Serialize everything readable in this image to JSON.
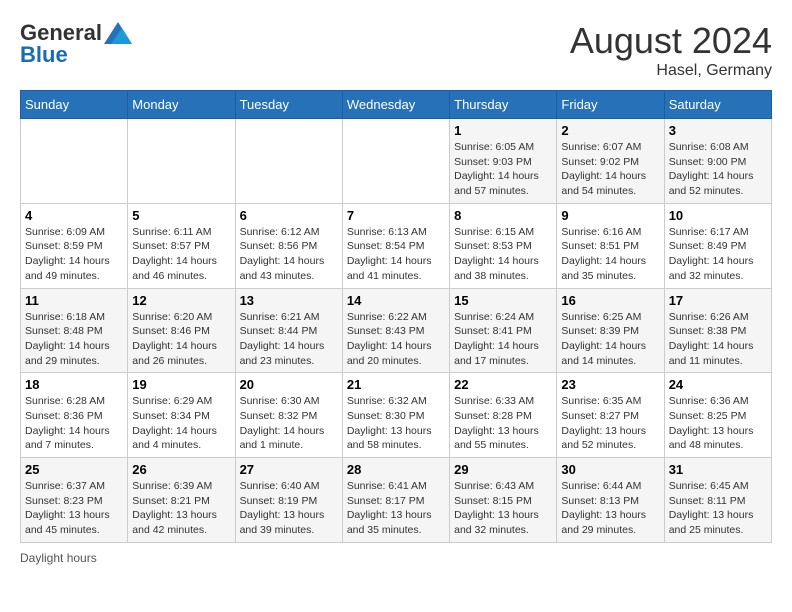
{
  "header": {
    "logo_general": "General",
    "logo_blue": "Blue",
    "month_year": "August 2024",
    "location": "Hasel, Germany"
  },
  "days_of_week": [
    "Sunday",
    "Monday",
    "Tuesday",
    "Wednesday",
    "Thursday",
    "Friday",
    "Saturday"
  ],
  "weeks": [
    [
      {
        "day": "",
        "info": ""
      },
      {
        "day": "",
        "info": ""
      },
      {
        "day": "",
        "info": ""
      },
      {
        "day": "",
        "info": ""
      },
      {
        "day": "1",
        "info": "Sunrise: 6:05 AM\nSunset: 9:03 PM\nDaylight: 14 hours and 57 minutes."
      },
      {
        "day": "2",
        "info": "Sunrise: 6:07 AM\nSunset: 9:02 PM\nDaylight: 14 hours and 54 minutes."
      },
      {
        "day": "3",
        "info": "Sunrise: 6:08 AM\nSunset: 9:00 PM\nDaylight: 14 hours and 52 minutes."
      }
    ],
    [
      {
        "day": "4",
        "info": "Sunrise: 6:09 AM\nSunset: 8:59 PM\nDaylight: 14 hours and 49 minutes."
      },
      {
        "day": "5",
        "info": "Sunrise: 6:11 AM\nSunset: 8:57 PM\nDaylight: 14 hours and 46 minutes."
      },
      {
        "day": "6",
        "info": "Sunrise: 6:12 AM\nSunset: 8:56 PM\nDaylight: 14 hours and 43 minutes."
      },
      {
        "day": "7",
        "info": "Sunrise: 6:13 AM\nSunset: 8:54 PM\nDaylight: 14 hours and 41 minutes."
      },
      {
        "day": "8",
        "info": "Sunrise: 6:15 AM\nSunset: 8:53 PM\nDaylight: 14 hours and 38 minutes."
      },
      {
        "day": "9",
        "info": "Sunrise: 6:16 AM\nSunset: 8:51 PM\nDaylight: 14 hours and 35 minutes."
      },
      {
        "day": "10",
        "info": "Sunrise: 6:17 AM\nSunset: 8:49 PM\nDaylight: 14 hours and 32 minutes."
      }
    ],
    [
      {
        "day": "11",
        "info": "Sunrise: 6:18 AM\nSunset: 8:48 PM\nDaylight: 14 hours and 29 minutes."
      },
      {
        "day": "12",
        "info": "Sunrise: 6:20 AM\nSunset: 8:46 PM\nDaylight: 14 hours and 26 minutes."
      },
      {
        "day": "13",
        "info": "Sunrise: 6:21 AM\nSunset: 8:44 PM\nDaylight: 14 hours and 23 minutes."
      },
      {
        "day": "14",
        "info": "Sunrise: 6:22 AM\nSunset: 8:43 PM\nDaylight: 14 hours and 20 minutes."
      },
      {
        "day": "15",
        "info": "Sunrise: 6:24 AM\nSunset: 8:41 PM\nDaylight: 14 hours and 17 minutes."
      },
      {
        "day": "16",
        "info": "Sunrise: 6:25 AM\nSunset: 8:39 PM\nDaylight: 14 hours and 14 minutes."
      },
      {
        "day": "17",
        "info": "Sunrise: 6:26 AM\nSunset: 8:38 PM\nDaylight: 14 hours and 11 minutes."
      }
    ],
    [
      {
        "day": "18",
        "info": "Sunrise: 6:28 AM\nSunset: 8:36 PM\nDaylight: 14 hours and 7 minutes."
      },
      {
        "day": "19",
        "info": "Sunrise: 6:29 AM\nSunset: 8:34 PM\nDaylight: 14 hours and 4 minutes."
      },
      {
        "day": "20",
        "info": "Sunrise: 6:30 AM\nSunset: 8:32 PM\nDaylight: 14 hours and 1 minute."
      },
      {
        "day": "21",
        "info": "Sunrise: 6:32 AM\nSunset: 8:30 PM\nDaylight: 13 hours and 58 minutes."
      },
      {
        "day": "22",
        "info": "Sunrise: 6:33 AM\nSunset: 8:28 PM\nDaylight: 13 hours and 55 minutes."
      },
      {
        "day": "23",
        "info": "Sunrise: 6:35 AM\nSunset: 8:27 PM\nDaylight: 13 hours and 52 minutes."
      },
      {
        "day": "24",
        "info": "Sunrise: 6:36 AM\nSunset: 8:25 PM\nDaylight: 13 hours and 48 minutes."
      }
    ],
    [
      {
        "day": "25",
        "info": "Sunrise: 6:37 AM\nSunset: 8:23 PM\nDaylight: 13 hours and 45 minutes."
      },
      {
        "day": "26",
        "info": "Sunrise: 6:39 AM\nSunset: 8:21 PM\nDaylight: 13 hours and 42 minutes."
      },
      {
        "day": "27",
        "info": "Sunrise: 6:40 AM\nSunset: 8:19 PM\nDaylight: 13 hours and 39 minutes."
      },
      {
        "day": "28",
        "info": "Sunrise: 6:41 AM\nSunset: 8:17 PM\nDaylight: 13 hours and 35 minutes."
      },
      {
        "day": "29",
        "info": "Sunrise: 6:43 AM\nSunset: 8:15 PM\nDaylight: 13 hours and 32 minutes."
      },
      {
        "day": "30",
        "info": "Sunrise: 6:44 AM\nSunset: 8:13 PM\nDaylight: 13 hours and 29 minutes."
      },
      {
        "day": "31",
        "info": "Sunrise: 6:45 AM\nSunset: 8:11 PM\nDaylight: 13 hours and 25 minutes."
      }
    ]
  ],
  "footer": {
    "daylight_hours_label": "Daylight hours"
  }
}
